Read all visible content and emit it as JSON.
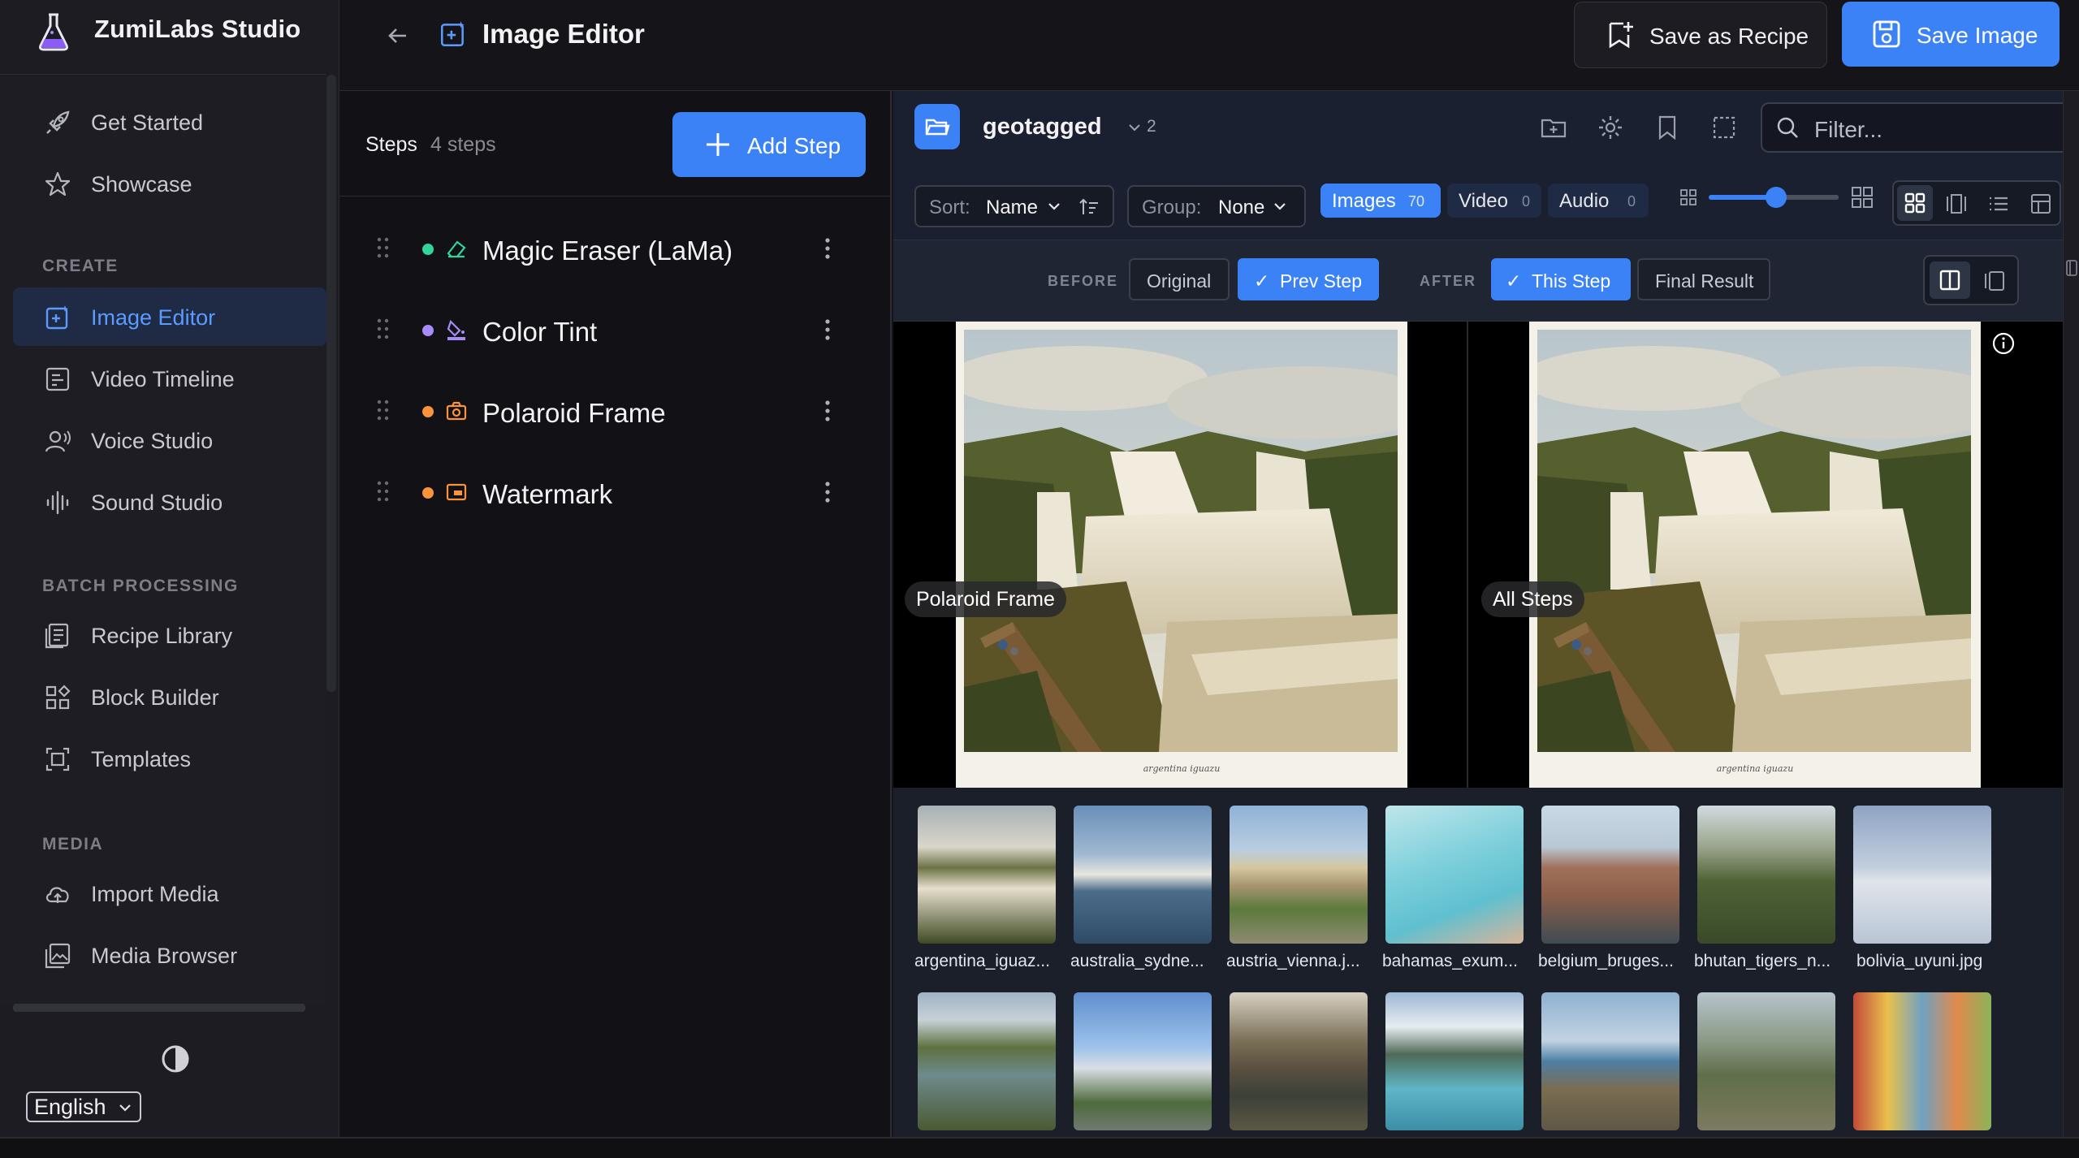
{
  "app": {
    "title": "ZumiLabs Studio"
  },
  "sidebar": {
    "top_items": [
      {
        "label": "Get Started",
        "icon": "rocket-icon"
      },
      {
        "label": "Showcase",
        "icon": "star-icon"
      }
    ],
    "sections": [
      {
        "label": "CREATE",
        "items": [
          {
            "label": "Image Editor",
            "icon": "image-edit-icon",
            "active": true
          },
          {
            "label": "Video Timeline",
            "icon": "timeline-icon"
          },
          {
            "label": "Voice Studio",
            "icon": "voice-icon"
          },
          {
            "label": "Sound Studio",
            "icon": "waveform-icon"
          }
        ]
      },
      {
        "label": "BATCH PROCESSING",
        "items": [
          {
            "label": "Recipe Library",
            "icon": "book-icon"
          },
          {
            "label": "Block Builder",
            "icon": "blocks-icon"
          },
          {
            "label": "Templates",
            "icon": "template-icon"
          }
        ]
      },
      {
        "label": "MEDIA",
        "items": [
          {
            "label": "Import Media",
            "icon": "cloud-upload-icon"
          },
          {
            "label": "Media Browser",
            "icon": "gallery-icon"
          }
        ]
      }
    ],
    "language": "English"
  },
  "header": {
    "title": "Image Editor",
    "save_recipe_label": "Save as Recipe",
    "save_image_label": "Save Image"
  },
  "steps_panel": {
    "title": "Steps",
    "count": "4 steps",
    "add_label": "Add Step",
    "steps": [
      {
        "label": "Magic Eraser (LaMa)",
        "dot_color": "#34d399",
        "icon": "eraser-icon"
      },
      {
        "label": "Color Tint",
        "dot_color": "#a78bfa",
        "icon": "paint-bucket-icon"
      },
      {
        "label": "Polaroid Frame",
        "dot_color": "#fb923c",
        "icon": "camera-icon"
      },
      {
        "label": "Watermark",
        "dot_color": "#fb923c",
        "icon": "watermark-icon"
      }
    ]
  },
  "browser": {
    "folder_name": "geotagged",
    "folder_count": "2",
    "filter_placeholder": "Filter...",
    "sort_key": "Sort:",
    "sort_value": "Name",
    "group_key": "Group:",
    "group_value": "None",
    "chips": [
      {
        "label": "Images",
        "count": "70",
        "active": true
      },
      {
        "label": "Video",
        "count": "0",
        "active": false
      },
      {
        "label": "Audio",
        "count": "0",
        "active": false
      }
    ],
    "thumb_size_fraction": 0.5
  },
  "compare": {
    "before_label": "BEFORE",
    "after_label": "AFTER",
    "before_options": [
      {
        "label": "Original",
        "active": false
      },
      {
        "label": "Prev Step",
        "active": true
      }
    ],
    "after_options": [
      {
        "label": "This Step",
        "active": true
      },
      {
        "label": "Final Result",
        "active": false
      }
    ],
    "left_caption": "Polaroid Frame",
    "right_caption": "All Steps",
    "polaroid_text": "argentina iguazu"
  },
  "gallery": {
    "items": [
      {
        "name": "argentina_iguaz..."
      },
      {
        "name": "australia_sydne..."
      },
      {
        "name": "austria_vienna.j..."
      },
      {
        "name": "bahamas_exum..."
      },
      {
        "name": "belgium_bruges..."
      },
      {
        "name": "bhutan_tigers_n..."
      },
      {
        "name": "bolivia_uyuni.jpg"
      }
    ]
  },
  "colors": {
    "accent": "#3b82f6",
    "active_nav_bg": "#1f2a45"
  }
}
